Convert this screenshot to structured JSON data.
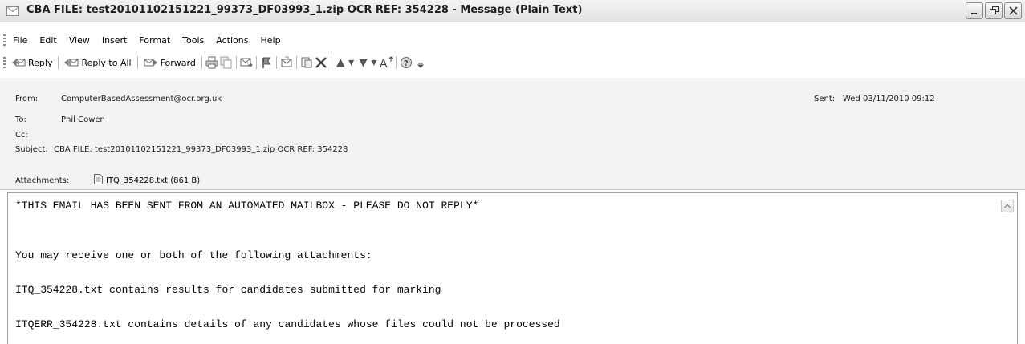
{
  "window": {
    "title": "CBA FILE: test20101102151221_99373_DF03993_1.zip OCR REF: 354228 - Message (Plain Text)"
  },
  "menu": [
    "File",
    "Edit",
    "View",
    "Insert",
    "Format",
    "Tools",
    "Actions",
    "Help"
  ],
  "toolbar": {
    "reply": "Reply",
    "reply_all": "Reply to All",
    "forward": "Forward"
  },
  "header": {
    "from_label": "From:",
    "from_value": "ComputerBasedAssessment@ocr.org.uk",
    "to_label": "To:",
    "to_value": "Phil Cowen",
    "cc_label": "Cc:",
    "cc_value": "",
    "subject_label": "Subject:",
    "subject_value": "CBA FILE: test20101102151221_99373_DF03993_1.zip OCR REF: 354228",
    "sent_label": "Sent:",
    "sent_value": "Wed 03/11/2010 09:12",
    "attachments_label": "Attachments:",
    "attachment_name": "ITQ_354228.txt (861 B)"
  },
  "body": {
    "lines": [
      "*THIS EMAIL HAS BEEN SENT FROM AN AUTOMATED MAILBOX - PLEASE DO NOT REPLY*",
      "You may receive one or both of the following attachments:",
      "ITQ_354228.txt contains results for candidates submitted for marking",
      "ITQERR_354228.txt contains details of any candidates whose files could not be processed"
    ]
  }
}
